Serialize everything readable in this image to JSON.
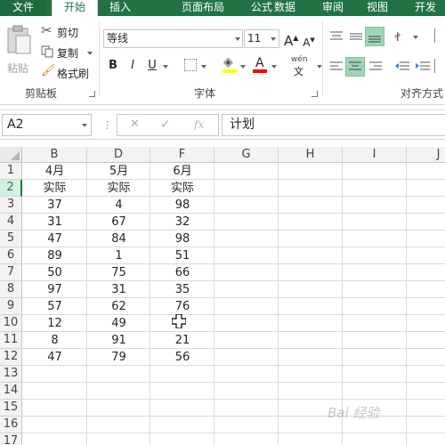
{
  "tabs": [
    "文件",
    "开始",
    "插入",
    "页面布局",
    "公式",
    "数据",
    "审阅",
    "视图",
    "开发"
  ],
  "clipboard": {
    "paste_label": "粘贴",
    "cut_label": "剪切",
    "copy_label": "复制",
    "format_painter_label": "格式刷",
    "group_label": "剪贴板"
  },
  "font": {
    "name": "等线",
    "size": "11",
    "bold": "B",
    "italic": "I",
    "underline": "U",
    "grow": "A",
    "shrink": "A",
    "color_letter": "A",
    "phonetic_top": "wén",
    "phonetic_bottom": "文",
    "group_label": "字体"
  },
  "alignment": {
    "group_label": "对齐方式"
  },
  "formula_bar": {
    "name_box": "A2",
    "cancel": "✕",
    "enter": "✓",
    "fx": "fx",
    "content": "计划"
  },
  "columns": [
    "B",
    "D",
    "F",
    "G",
    "H",
    "I",
    "J"
  ],
  "row_numbers": [
    "1",
    "2",
    "3",
    "4",
    "5",
    "6",
    "7",
    "8",
    "9",
    "10",
    "11",
    "12",
    "13",
    "14",
    "15",
    "16",
    "17"
  ],
  "table": {
    "header_months": [
      "4月",
      "5月",
      "6月"
    ],
    "header_sub": [
      "实际",
      "实际",
      "实际"
    ],
    "rows": [
      [
        "37",
        "4",
        "98"
      ],
      [
        "31",
        "67",
        "32"
      ],
      [
        "47",
        "84",
        "98"
      ],
      [
        "89",
        "1",
        "51"
      ],
      [
        "50",
        "75",
        "66"
      ],
      [
        "97",
        "31",
        "35"
      ],
      [
        "57",
        "62",
        "76"
      ],
      [
        "12",
        "49",
        ""
      ],
      [
        "8",
        "91",
        "21"
      ],
      [
        "47",
        "79",
        "56"
      ]
    ]
  },
  "accent_color": "#217346"
}
